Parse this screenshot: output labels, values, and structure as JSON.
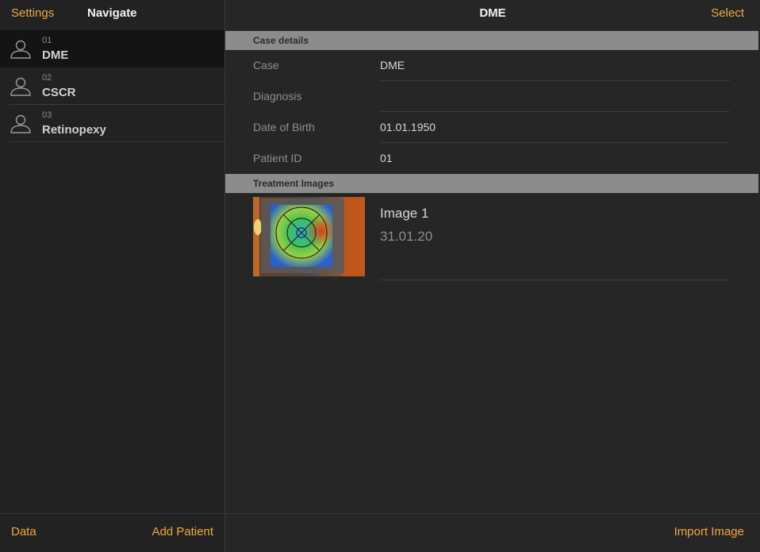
{
  "sidebar": {
    "settings_label": "Settings",
    "title": "Navigate",
    "items": [
      {
        "number": "01",
        "name": "DME",
        "icon": "person-icon"
      },
      {
        "number": "02",
        "name": "CSCR",
        "icon": "person-icon"
      },
      {
        "number": "03",
        "name": "Retinopexy",
        "icon": "person-icon"
      }
    ],
    "footer": {
      "data_label": "Data",
      "add_patient_label": "Add Patient"
    }
  },
  "main": {
    "title": "DME",
    "select_label": "Select",
    "case_details": {
      "header": "Case details",
      "rows": [
        {
          "label": "Case",
          "value": "DME"
        },
        {
          "label": "Diagnosis",
          "value": ""
        },
        {
          "label": "Date of Birth",
          "value": "01.01.1950"
        },
        {
          "label": "Patient ID",
          "value": "01"
        }
      ]
    },
    "treatment_images": {
      "header": "Treatment Images",
      "items": [
        {
          "title": "Image 1",
          "date": "31.01.20"
        }
      ]
    },
    "footer": {
      "import_label": "Import Image"
    }
  },
  "colors": {
    "accent": "#f2a83b",
    "background": "#262626",
    "sidebar": "#222222",
    "section_header": "#8c8c8c"
  }
}
